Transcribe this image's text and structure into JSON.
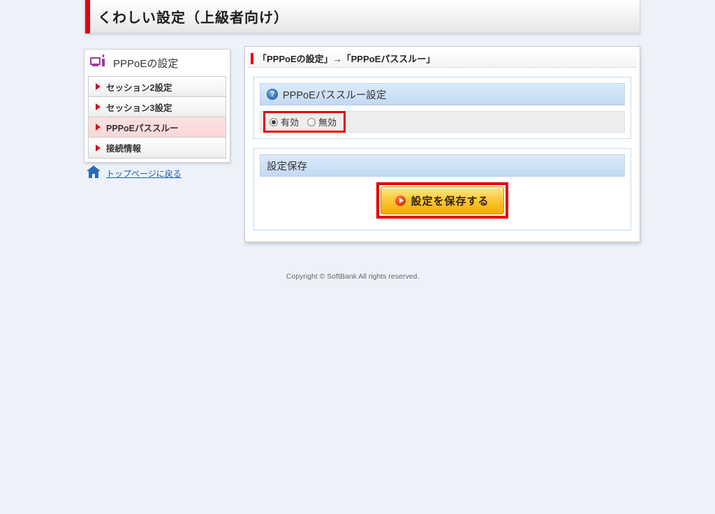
{
  "page": {
    "title": "くわしい設定（上級者向け）",
    "footer": "Copyright © SoftBank All rights reserved."
  },
  "sidebar": {
    "title": "PPPoEの設定",
    "items": [
      {
        "label": "セッション2設定",
        "active": false
      },
      {
        "label": "セッション3設定",
        "active": false
      },
      {
        "label": "PPPoEパススルー",
        "active": true
      },
      {
        "label": "接続情報",
        "active": false
      }
    ],
    "home_link": "トップページに戻る"
  },
  "main": {
    "breadcrumb": "「PPPoEの設定」→「PPPoEパススルー」",
    "passthrough_section": {
      "help_icon": "?",
      "title": "PPPoEパススルー設定",
      "options": [
        {
          "label": "有効",
          "selected": true
        },
        {
          "label": "無効",
          "selected": false
        }
      ]
    },
    "save_section": {
      "title": "設定保存",
      "button_label": "設定を保存する"
    }
  },
  "colors": {
    "annotation_red": "#e60000",
    "accent_red": "#e60012",
    "active_item_pink": "#fad7d7",
    "section_header_blue": "#cde0f6",
    "button_orange": "#f6ab00",
    "link_blue": "#1a5dab",
    "icon_purple": "#9b3d9b"
  }
}
